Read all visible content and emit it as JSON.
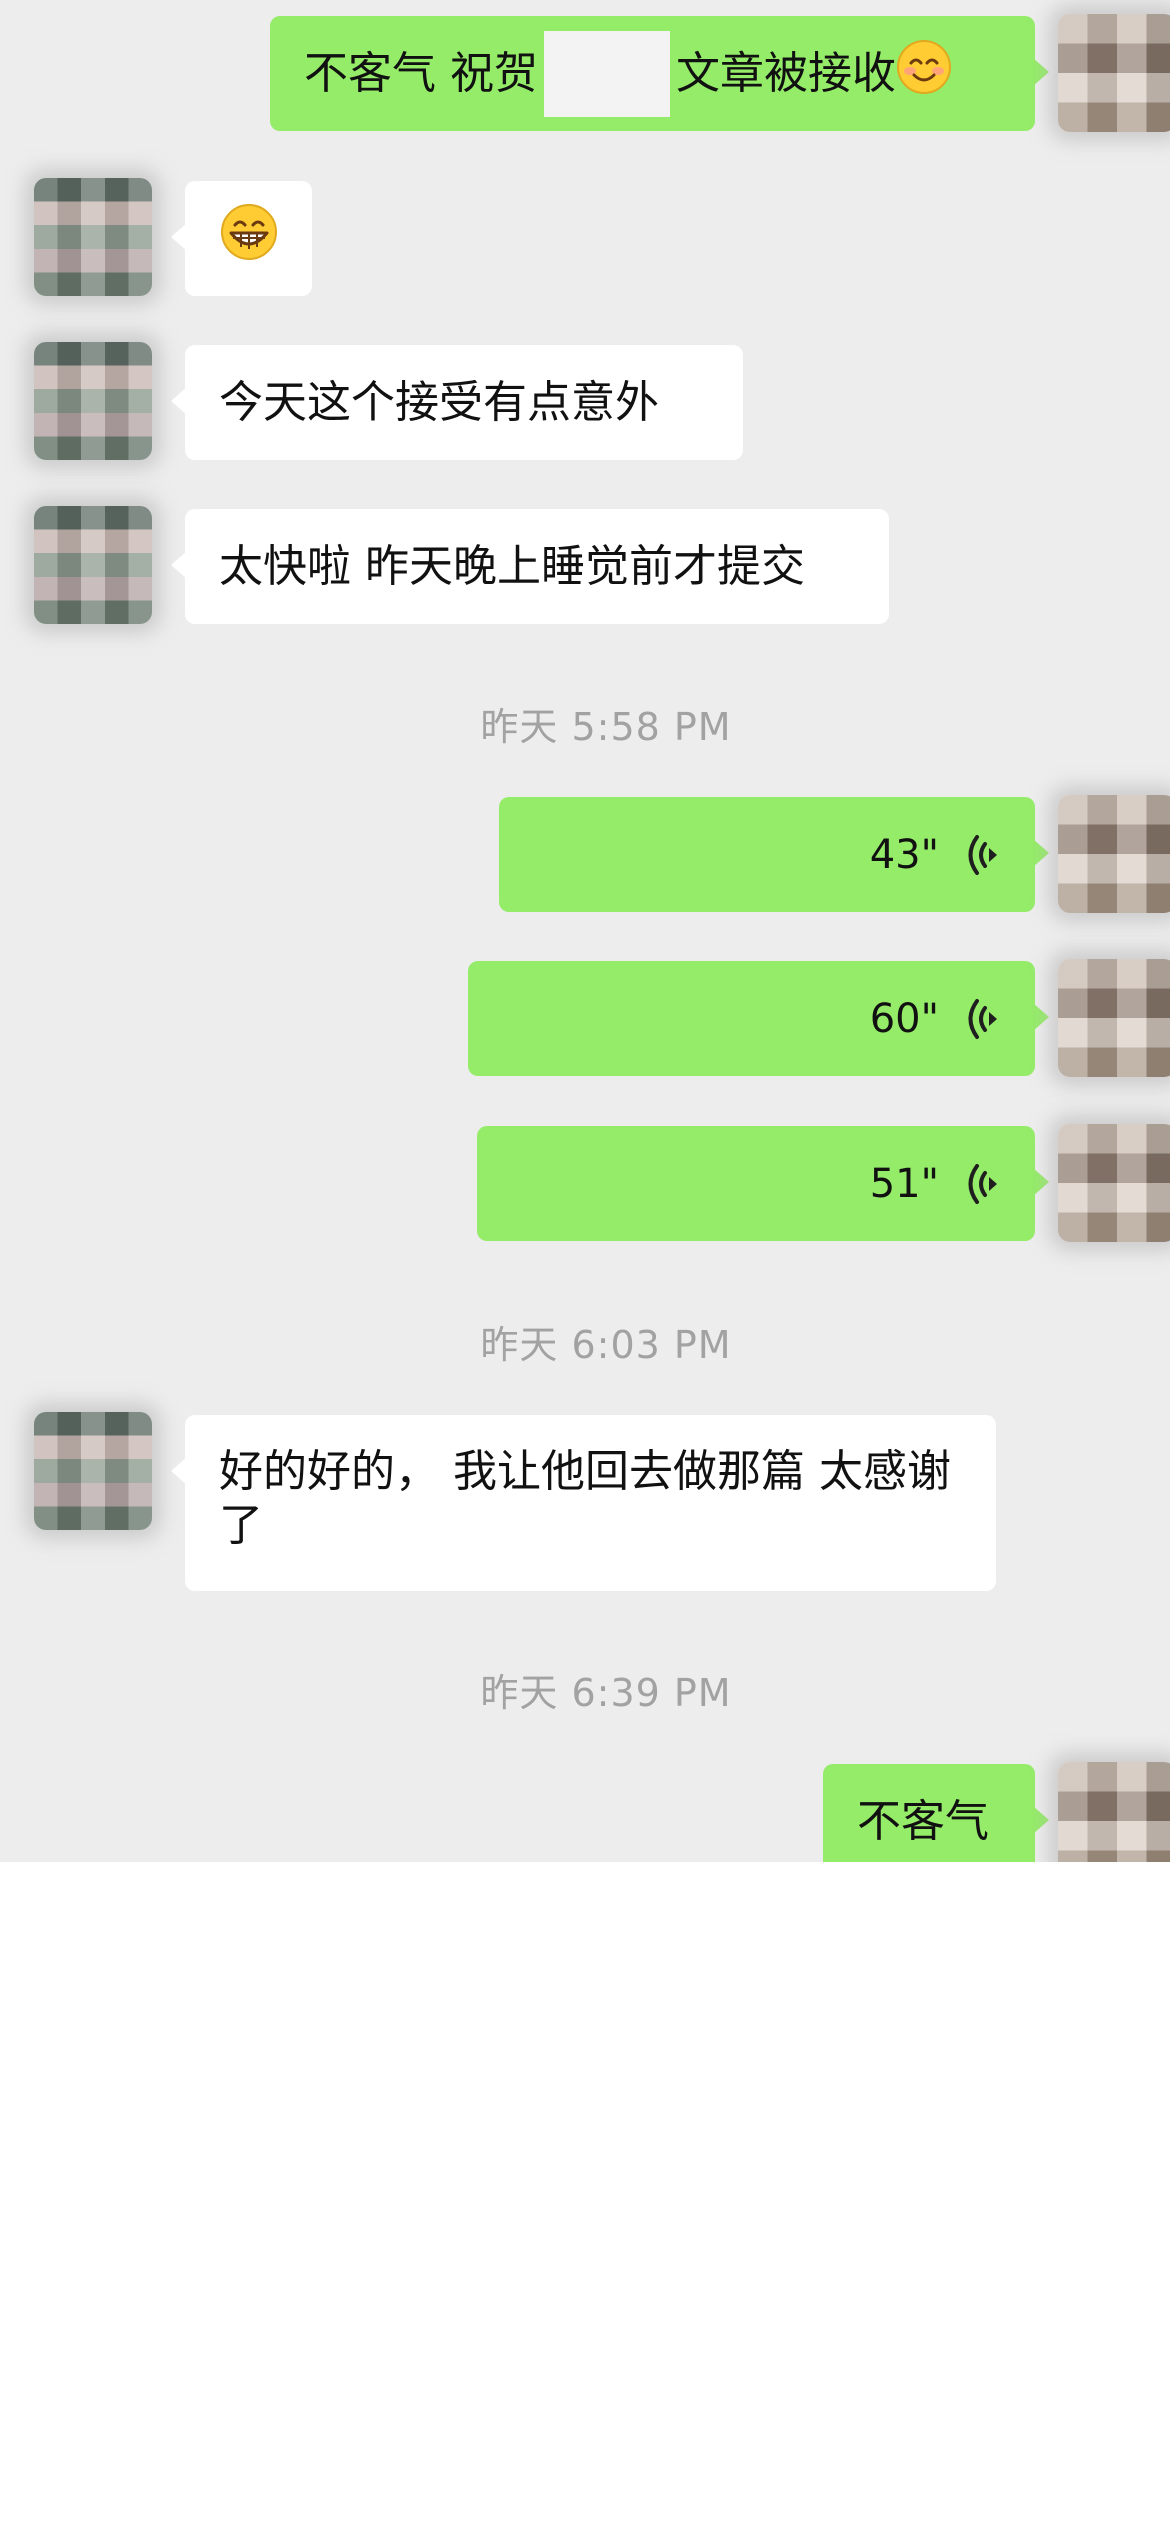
{
  "messages": [
    {
      "side": "out",
      "type": "text",
      "pre": "不客气  祝贺",
      "post": "文章被接收",
      "emoji": "smiling-face-icon"
    },
    {
      "side": "in",
      "type": "emoji",
      "emoji": "grinning-face-icon"
    },
    {
      "side": "in",
      "type": "text",
      "text": "今天这个接受有点意外"
    },
    {
      "side": "in",
      "type": "text",
      "text": "太快啦 昨天晚上睡觉前才提交"
    },
    {
      "type": "timestamp",
      "text": "昨天 5:58 PM"
    },
    {
      "side": "out",
      "type": "voice",
      "duration": "43\""
    },
    {
      "side": "out",
      "type": "voice",
      "duration": "60\""
    },
    {
      "side": "out",
      "type": "voice",
      "duration": "51\""
    },
    {
      "type": "timestamp",
      "text": "昨天 6:03 PM"
    },
    {
      "side": "in",
      "type": "text",
      "text": "好的好的， 我让他回去做那篇 太感谢了"
    },
    {
      "type": "timestamp",
      "text": "昨天 6:39 PM"
    },
    {
      "side": "out",
      "type": "text",
      "text": "不客气"
    }
  ],
  "colors": {
    "outgoing_bubble": "#95ec69",
    "incoming_bubble": "#ffffff",
    "chat_background": "#ededed",
    "timestamp_text": "#a2a2a2"
  }
}
